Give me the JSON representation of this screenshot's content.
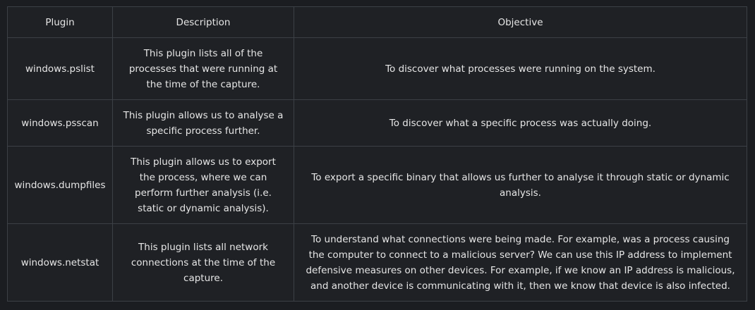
{
  "table": {
    "headers": [
      "Plugin",
      "Description",
      "Objective"
    ],
    "rows": [
      {
        "plugin": "windows.pslist",
        "description": "This plugin lists all of the processes that were running at the time of the capture.",
        "objective": "To discover what processes were running on the system."
      },
      {
        "plugin": "windows.psscan",
        "description": "This plugin allows us to analyse a specific process further.",
        "objective": "To discover what a specific process was actually doing."
      },
      {
        "plugin": "windows.dumpfiles",
        "description": "This plugin allows us to export the process, where we can perform further analysis (i.e. static or dynamic analysis).",
        "objective": "To export a specific binary that allows us further to analyse it through static or dynamic analysis."
      },
      {
        "plugin": "windows.netstat",
        "description": "This plugin lists all network connections at the time of the capture.",
        "objective": "To understand what connections were being made. For example, was a process causing the computer to connect to a malicious server? We can use this IP address to implement defensive measures on other devices. For example, if we know an IP address is malicious, and another device is communicating with it, then we know that device is also infected."
      }
    ]
  },
  "colors": {
    "background": "#1b1d21",
    "cell_background": "#1f2125",
    "border": "#3c4046",
    "text": "#e6e6e6"
  }
}
